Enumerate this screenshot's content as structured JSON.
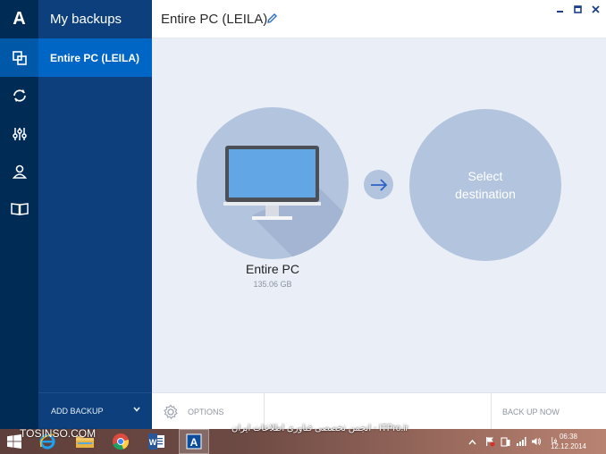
{
  "app": {
    "logo_letter": "A"
  },
  "rail": {
    "items": [
      {
        "icon": "backups-icon",
        "active": true
      },
      {
        "icon": "sync-icon",
        "active": false
      },
      {
        "icon": "tools-icon",
        "active": false
      },
      {
        "icon": "account-icon",
        "active": false
      },
      {
        "icon": "help-book-icon",
        "active": false
      }
    ]
  },
  "sidebar": {
    "title": "My backups",
    "items": [
      {
        "label": "Entire PC (LEILA)",
        "selected": true
      }
    ],
    "add_backup_label": "ADD BACKUP"
  },
  "header": {
    "title": "Entire PC (LEILA)"
  },
  "main": {
    "source": {
      "name": "Entire PC",
      "size": "135.06 GB"
    },
    "destination": {
      "label": "Select destination"
    }
  },
  "footer": {
    "options_label": "OPTIONS",
    "back_up_now_label": "BACK UP NOW"
  },
  "watermark": {
    "left_text": "TOSINSO.COM",
    "mid_text": "ITPro.ir - انجمن تخصصی فناوری اطلاعات ایران"
  },
  "taskbar": {
    "time": "06:38",
    "date": "12.12.2014",
    "language": "فا"
  },
  "colors": {
    "rail_bg": "#002b55",
    "panel_bg": "#0c3f7b",
    "active_item_bg": "#0066c6",
    "circle_bg": "#b3c4de",
    "main_bg": "#eaeef6",
    "accent": "#0066c6"
  }
}
